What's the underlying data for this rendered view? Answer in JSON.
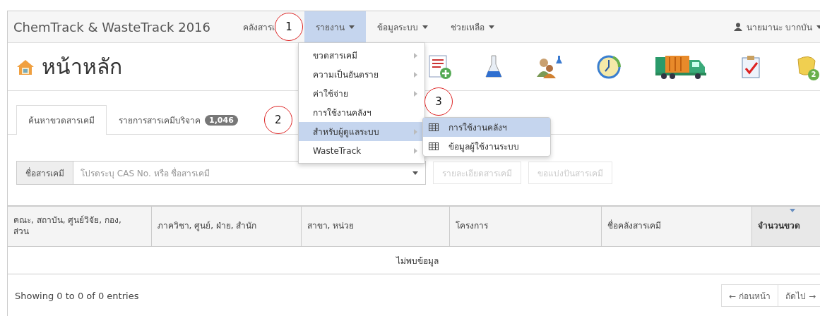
{
  "navbar": {
    "brand": "ChemTrack & WasteTrack 2016",
    "menus": [
      {
        "label": "คลังสารเ",
        "caret": false,
        "selected": false
      },
      {
        "label": "รายงาน",
        "caret": true,
        "selected": true
      },
      {
        "label": "ข้อมูลระบบ",
        "caret": true,
        "selected": false
      },
      {
        "label": "ช่วยเหลือ",
        "caret": true,
        "selected": false
      }
    ],
    "user": "นายมานะ บากบัน"
  },
  "page_title": "หน้าหลัก",
  "notification_count": "2",
  "dropdown": {
    "items": [
      {
        "label": "ขวดสารเคมี",
        "submenu": true,
        "selected": false
      },
      {
        "label": "ความเป็นอันตราย",
        "submenu": true,
        "selected": false
      },
      {
        "label": "ค่าใช้จ่าย",
        "submenu": true,
        "selected": false
      },
      {
        "label": "การใช้งานคลังฯ",
        "submenu": false,
        "selected": false
      },
      {
        "label": "สำหรับผู้ดูแลระบบ",
        "submenu": true,
        "selected": true
      },
      {
        "label": "WasteTrack",
        "submenu": true,
        "selected": false
      }
    ]
  },
  "submenu": {
    "items": [
      {
        "label": "การใช้งานคลังฯ",
        "selected": true
      },
      {
        "label": "ข้อมูลผู้ใช้งานระบบ",
        "selected": false
      }
    ]
  },
  "callouts": [
    "1",
    "2",
    "3"
  ],
  "tabs": [
    {
      "label": "ค้นหาขวดสารเคมี",
      "selected": true
    },
    {
      "label": "รายการสารเคมีบริจาค",
      "badge": "1,046",
      "selected": false
    }
  ],
  "search": {
    "label": "ชื่อสารเคมี",
    "placeholder": "โปรดระบุ CAS No. หรือ ชื่อสารเคมี"
  },
  "actions": [
    {
      "label": "รายละเอียดสารเคมี",
      "disabled": true
    },
    {
      "label": "ขอแบ่งปันสารเคมี",
      "disabled": true
    }
  ],
  "table": {
    "columns": [
      {
        "label": "คณะ, สถาบัน, ศูนย์วิจัย, กอง, ส่วน",
        "sorted": false
      },
      {
        "label": "ภาควิชา, ศูนย์, ฝ่าย, สำนัก",
        "sorted": false
      },
      {
        "label": "สาขา, หน่วย",
        "sorted": false
      },
      {
        "label": "โครงการ",
        "sorted": false
      },
      {
        "label": "ชื่อคลังสารเคมี",
        "sorted": false
      },
      {
        "label": "จำนวนขวด",
        "sorted": true
      }
    ],
    "empty_message": "ไม่พบข้อมูล"
  },
  "footer": {
    "info": "Showing 0 to 0 of 0 entries",
    "pagination": [
      "← ก่อนหน้า",
      "ถัดไป →"
    ]
  }
}
